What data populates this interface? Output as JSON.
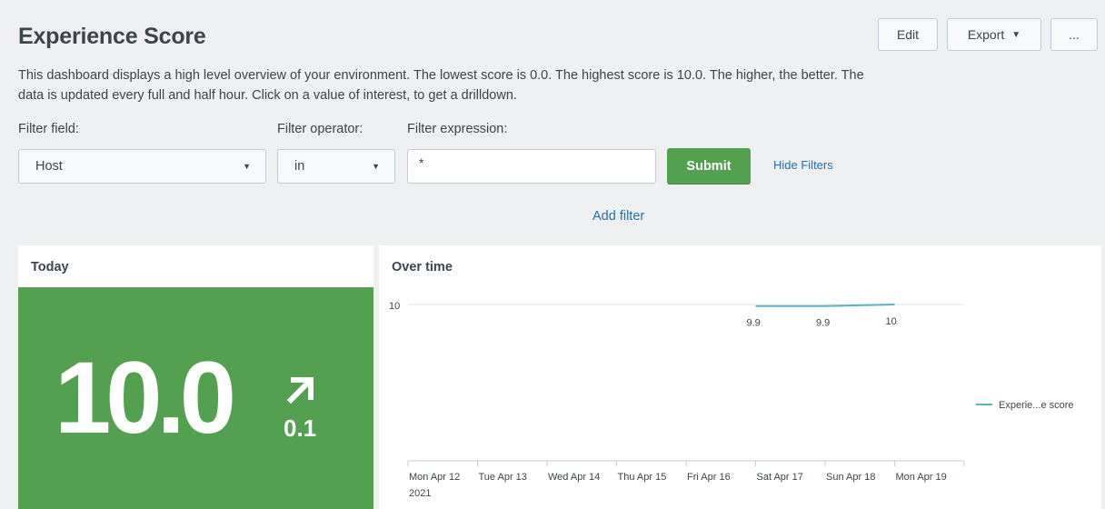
{
  "header": {
    "title": "Experience Score",
    "description": "This dashboard displays a high level overview of your environment. The lowest score is 0.0. The highest score is 10.0. The higher, the better. The data is updated every full and half hour. Click on a value of interest, to get a drilldown."
  },
  "toolbar": {
    "edit_label": "Edit",
    "export_label": "Export",
    "more_label": "..."
  },
  "filters": {
    "field_label": "Filter field:",
    "field_value": "Host",
    "operator_label": "Filter operator:",
    "operator_value": "in",
    "expression_label": "Filter expression:",
    "expression_value": "*",
    "submit_label": "Submit",
    "hide_filters_label": "Hide Filters",
    "add_filter_label": "Add filter"
  },
  "today_panel": {
    "title": "Today",
    "score": "10.0",
    "delta": "0.1",
    "color": "#53a051"
  },
  "overtime_panel": {
    "title": "Over time"
  },
  "chart_data": {
    "type": "line",
    "x": [
      "Mon Apr 12",
      "Tue Apr 13",
      "Wed Apr 14",
      "Thu Apr 15",
      "Fri Apr 16",
      "Sat Apr 17",
      "Sun Apr 18",
      "Mon Apr 19"
    ],
    "x_year_label": "2021",
    "series": [
      {
        "name": "Experie...e score",
        "values": [
          null,
          null,
          null,
          null,
          null,
          9.9,
          9.9,
          10
        ],
        "labels": [
          "",
          "",
          "",
          "",
          "",
          "9.9",
          "9.9",
          "10"
        ],
        "color": "#5bb3bf"
      }
    ],
    "y_tick_labels": [
      "10"
    ],
    "ylim": [
      0,
      10
    ],
    "grid": true,
    "legend_position": "right"
  }
}
